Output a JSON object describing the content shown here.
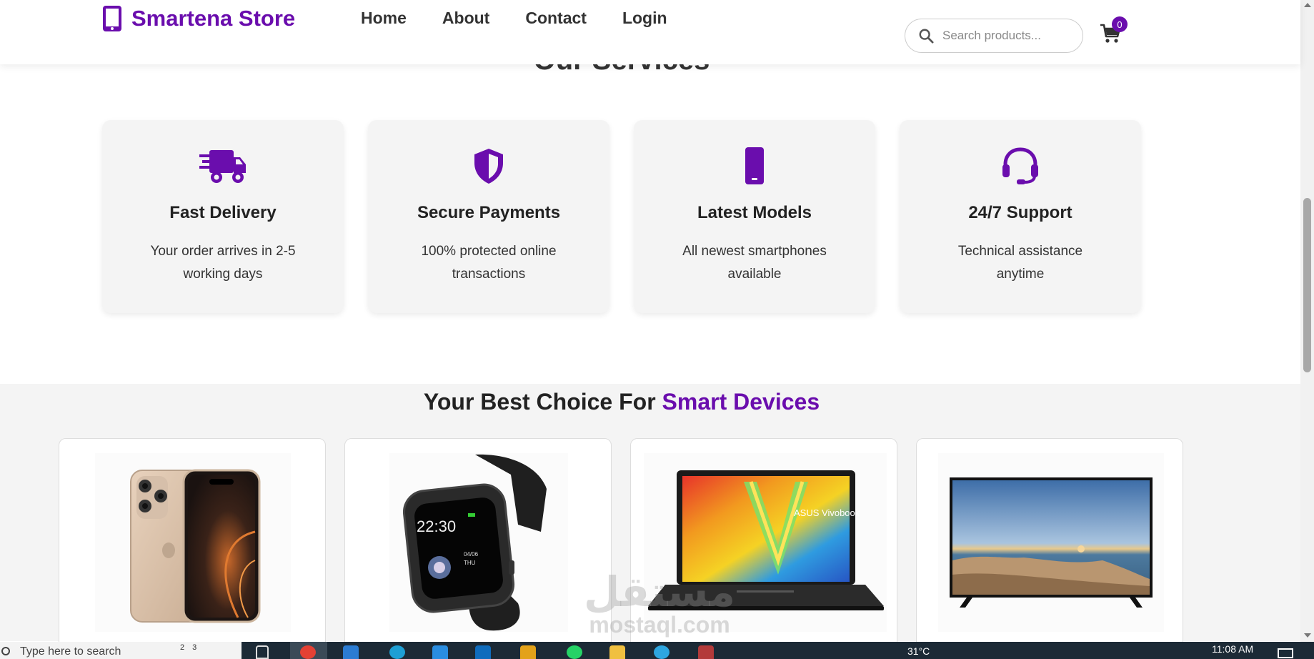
{
  "header": {
    "brand": "Smartena Store",
    "nav": [
      "Home",
      "About",
      "Contact",
      "Login"
    ],
    "search_placeholder": "Search products...",
    "cart_count": "0"
  },
  "services": {
    "title": "Our Services",
    "items": [
      {
        "title": "Fast Delivery",
        "desc": "Your order arrives in 2-5 working days",
        "icon": "truck-icon"
      },
      {
        "title": "Secure Payments",
        "desc": "100% protected online transactions",
        "icon": "shield-icon"
      },
      {
        "title": "Latest Models",
        "desc": "All newest smartphones available",
        "icon": "phone-icon"
      },
      {
        "title": "24/7 Support",
        "desc": "Technical assistance anytime",
        "icon": "headset-icon"
      }
    ]
  },
  "products": {
    "title_prefix": "Your Best Choice For",
    "title_accent": "Smart Devices",
    "items": [
      {
        "image": "smartphone-image"
      },
      {
        "image": "smartwatch-image",
        "watch_time": "22:30",
        "watch_date": "04/06",
        "watch_day": "THU"
      },
      {
        "image": "laptop-image",
        "screen_text": "ASUS Vivobook"
      },
      {
        "image": "tv-image"
      }
    ]
  },
  "watermark": {
    "line1": "مستقل",
    "line2": "mostaql.com"
  },
  "taskbar": {
    "search_text": "Type here to search",
    "widget_text": "2 3",
    "weather": "31°C",
    "clock": "11:08 AM"
  },
  "colors": {
    "accent": "#6a0dad",
    "text": "#333333",
    "card_bg": "#f4f4f4"
  }
}
